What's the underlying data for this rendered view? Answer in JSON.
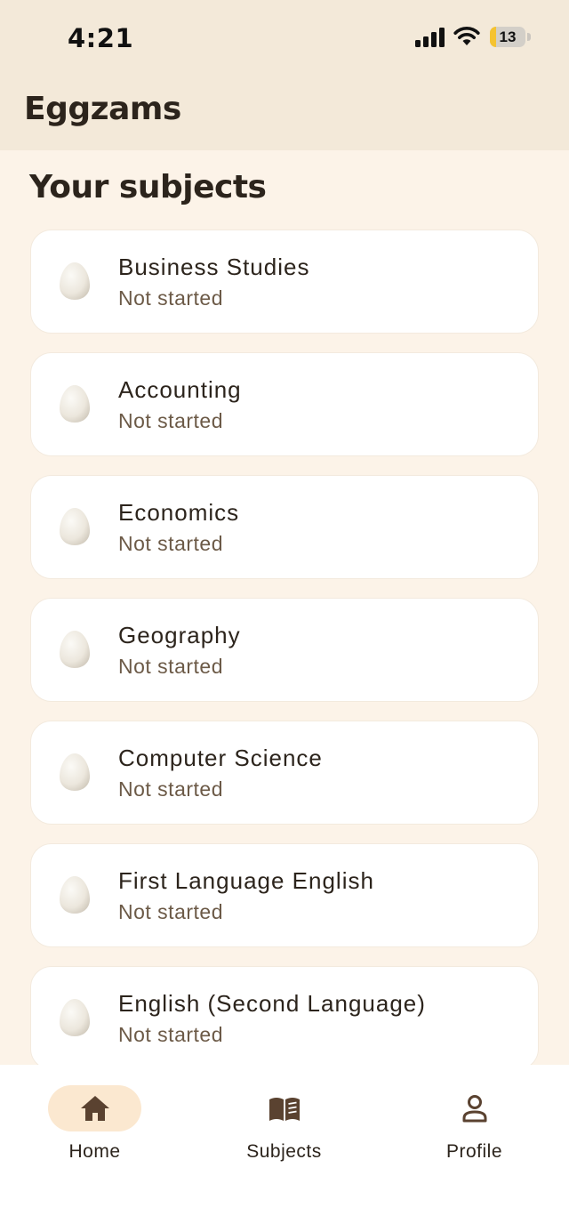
{
  "status_bar": {
    "time": "4:21",
    "battery_level": "13",
    "icons": [
      "cellular-signal-icon",
      "wifi-icon",
      "battery-icon"
    ]
  },
  "header": {
    "title": "Eggzams"
  },
  "main": {
    "section_title": "Your subjects",
    "subjects": [
      {
        "name": "Business Studies",
        "status": "Not started",
        "icon": "egg-icon"
      },
      {
        "name": "Accounting",
        "status": "Not started",
        "icon": "egg-icon"
      },
      {
        "name": "Economics",
        "status": "Not started",
        "icon": "egg-icon"
      },
      {
        "name": "Geography",
        "status": "Not started",
        "icon": "egg-icon"
      },
      {
        "name": "Computer Science",
        "status": "Not started",
        "icon": "egg-icon"
      },
      {
        "name": "First Language English",
        "status": "Not started",
        "icon": "egg-icon"
      },
      {
        "name": "English (Second Language)",
        "status": "Not started",
        "icon": "egg-icon"
      }
    ]
  },
  "bottom_nav": {
    "items": [
      {
        "label": "Home",
        "icon": "home-icon",
        "active": true
      },
      {
        "label": "Subjects",
        "icon": "book-icon",
        "active": false
      },
      {
        "label": "Profile",
        "icon": "profile-icon",
        "active": false
      }
    ]
  },
  "colors": {
    "header_bg": "#f3e9d9",
    "page_bg": "#fcf3e8",
    "card_bg": "#ffffff",
    "text_primary": "#2c241c",
    "text_secondary": "#6c5a47",
    "nav_active_pill": "#fbe8d0",
    "nav_icon": "#5a4230",
    "battery_accent": "#f5c331"
  }
}
